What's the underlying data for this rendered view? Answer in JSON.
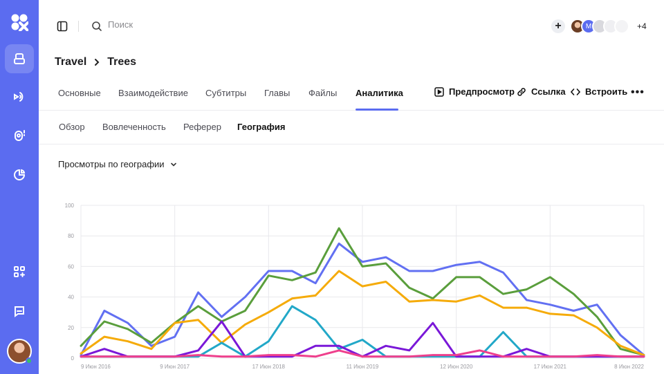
{
  "search": {
    "placeholder": "Поиск"
  },
  "header": {
    "add_label": "+",
    "avatar_initial": "M",
    "more_count": "+4"
  },
  "breadcrumb": {
    "items": [
      "Travel",
      "Trees"
    ]
  },
  "tabs": [
    {
      "label": "Основные"
    },
    {
      "label": "Взаимодействие"
    },
    {
      "label": "Субтитры"
    },
    {
      "label": "Главы"
    },
    {
      "label": "Файлы"
    },
    {
      "label": "Аналитика",
      "active": true
    }
  ],
  "actions": {
    "preview": "Предпросмотр",
    "link": "Ссылка",
    "embed": "Встроить"
  },
  "subtabs": [
    {
      "label": "Обзор"
    },
    {
      "label": "Вовлеченность"
    },
    {
      "label": "Реферер"
    },
    {
      "label": "География",
      "active": true
    }
  ],
  "filter": {
    "label": "Просмотры по географии"
  },
  "colors": {
    "accent": "#5b6cf0"
  },
  "chart_data": {
    "type": "line",
    "ylim": [
      0,
      100
    ],
    "yticks": [
      0,
      20,
      40,
      60,
      80,
      100
    ],
    "xtick_labels": [
      "9 Июн 2016",
      "9 Июн 2017",
      "17 Июн 2018",
      "11 Июн 2019",
      "12 Июн 2020",
      "17 Июн 2021",
      "8 Июн 2022"
    ],
    "series": [
      {
        "color": "#6270f2",
        "values": [
          2,
          31,
          23,
          8,
          14,
          43,
          27,
          40,
          57,
          57,
          49,
          75,
          63,
          66,
          57,
          57,
          61,
          63,
          56,
          38,
          35,
          31,
          35,
          15,
          2
        ]
      },
      {
        "color": "#5a9e3c",
        "values": [
          8,
          24,
          19,
          10,
          23,
          34,
          24,
          31,
          54,
          51,
          56,
          85,
          60,
          62,
          46,
          39,
          53,
          53,
          42,
          45,
          53,
          42,
          27,
          6,
          2
        ]
      },
      {
        "color": "#f5ab0a",
        "values": [
          3,
          14,
          11,
          6,
          23,
          25,
          10,
          22,
          30,
          39,
          41,
          57,
          47,
          50,
          37,
          38,
          37,
          41,
          33,
          33,
          29,
          28,
          20,
          8,
          2
        ]
      },
      {
        "color": "#22a8c8",
        "values": [
          1,
          1,
          1,
          1,
          1,
          1,
          10,
          1,
          11,
          34,
          25,
          6,
          12,
          1,
          1,
          1,
          1,
          1,
          17,
          1,
          1,
          1,
          1,
          1,
          1
        ]
      },
      {
        "color": "#7a18d8",
        "values": [
          1,
          6,
          1,
          1,
          1,
          5,
          24,
          1,
          1,
          1,
          8,
          8,
          1,
          8,
          5,
          23,
          1,
          1,
          1,
          6,
          1,
          1,
          1,
          1,
          1
        ]
      },
      {
        "color": "#ee3f8c",
        "values": [
          1,
          1,
          1,
          1,
          1,
          2,
          1,
          1,
          2,
          2,
          1,
          5,
          1,
          1,
          1,
          2,
          2,
          5,
          1,
          1,
          1,
          1,
          2,
          1,
          1
        ]
      }
    ]
  }
}
